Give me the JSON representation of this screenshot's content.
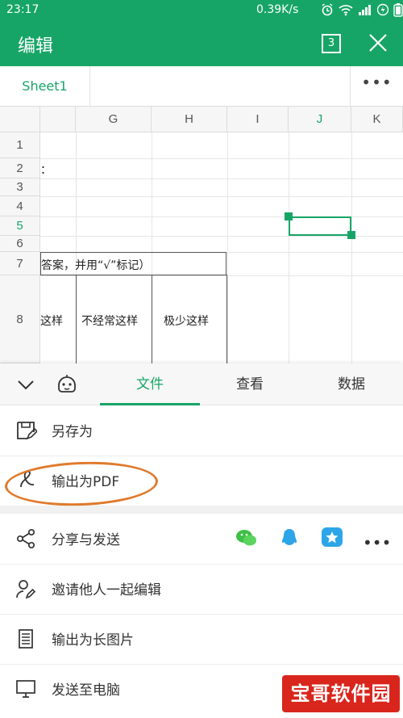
{
  "status": {
    "time": "23:17",
    "network": "0.39K/s"
  },
  "appbar": {
    "title": "编辑",
    "window_count": "3"
  },
  "sheet": {
    "tab_label": "Sheet1",
    "more": "•••"
  },
  "grid": {
    "columns": [
      "G",
      "H",
      "I",
      "J",
      "K"
    ],
    "rows": [
      "1",
      "2",
      "3",
      "4",
      "5",
      "6",
      "7",
      "8"
    ],
    "cells": {
      "r2": "：",
      "r7": "答案，并用“√”标记）",
      "r8_a": "这样",
      "r8_b": "不经常这样",
      "r8_c": "极少这样"
    }
  },
  "panel": {
    "tabs": [
      "文件",
      "查看",
      "数据"
    ],
    "active_tab": "文件",
    "items": {
      "save_as": "另存为",
      "export_pdf": "输出为PDF",
      "share": "分享与发送",
      "invite": "邀请他人一起编辑",
      "long_image": "输出为长图片",
      "send_pc": "发送至电脑"
    },
    "share_more": "•••"
  },
  "watermark": "宝哥软件园",
  "colors": {
    "primary": "#17a567",
    "annotation": "#e07a2c",
    "watermark": "#d9261c"
  }
}
